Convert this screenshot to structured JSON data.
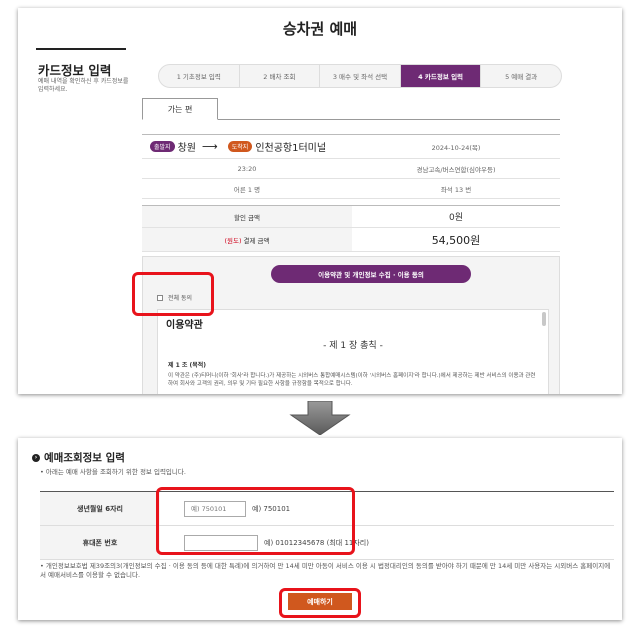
{
  "top": {
    "page_title": "승차권 예매",
    "side_title": "카드정보 입력",
    "side_desc": "예매 내역을 확인하신 후 카드정보를 입력하세요.",
    "steps": [
      {
        "label": "1 기초정보 입력",
        "active": false
      },
      {
        "label": "2 배차 조회",
        "active": false
      },
      {
        "label": "3 매수 및 좌석 선택",
        "active": false
      },
      {
        "label": "4 카드정보 입력",
        "active": true
      },
      {
        "label": "5 예매 결과",
        "active": false
      }
    ],
    "tab_label": "가는 편",
    "route": {
      "dep_badge": "출발지",
      "dep_name": "창원",
      "arrow": "⟶",
      "arr_badge": "도착지",
      "arr_name": "인천공항1터미널",
      "date": "2024-10-24(목)",
      "time": "23:20",
      "company": "경남고속/버스연합(심야우등)",
      "passengers": "어른 1 명",
      "seat": "좌석 13 번"
    },
    "fare": {
      "discount_label": "할인 금액",
      "discount_value": "0원",
      "refund_tag": "(원도)",
      "pay_label": "결제 금액",
      "pay_value": "54,500원"
    },
    "consent": {
      "button": "이용약관 및 개인정보 수집 · 이용 동의",
      "check_label": "전체 동의",
      "terms_title": "이용약관",
      "chapter": "- 제 1 장 총칙 -",
      "article": "제 1 조 (목적)",
      "body": "이 약관은 (주)티머니(이하 '회사'라 합니다.)가 제공하는 시외버스 통합예매시스템(이하 '시외버스 홈페이지'라 합니다.)에서 제공하는 제반 서비스의 이용과 관련하여 회사와 고객의 권리, 의무 및 기타 필요한 사항을 규정함을 목적으로 합니다."
    }
  },
  "bottom": {
    "title": "예매조회정보 입력",
    "subtitle": "• 아래는 예매 사항을 조회하기 위한 정보 입력입니다.",
    "birth_label": "생년월일 6자리",
    "birth_placeholder": "예) 750101",
    "birth_hint": "예) 750101",
    "phone_label": "휴대폰 번호",
    "phone_placeholder": "",
    "phone_hint": "예) 01012345678 (최대 11자리)",
    "note": "• 개인정보보호법 제39조의3(개인정보의 수집 · 이용 동의 등에 대한 특례)에 의거하여 만 14세 미만 아동이 서비스 이용 시 법정대리인의 동의를 받아야 하기 때문에 만 14세 미만 사용자는 시외버스 홈페이지에서 예매서비스를 이용할 수 없습니다.",
    "submit": "예매하기"
  },
  "colors": {
    "accent": "#6e2a74",
    "orange": "#d0581e",
    "highlight": "#e8131b"
  }
}
